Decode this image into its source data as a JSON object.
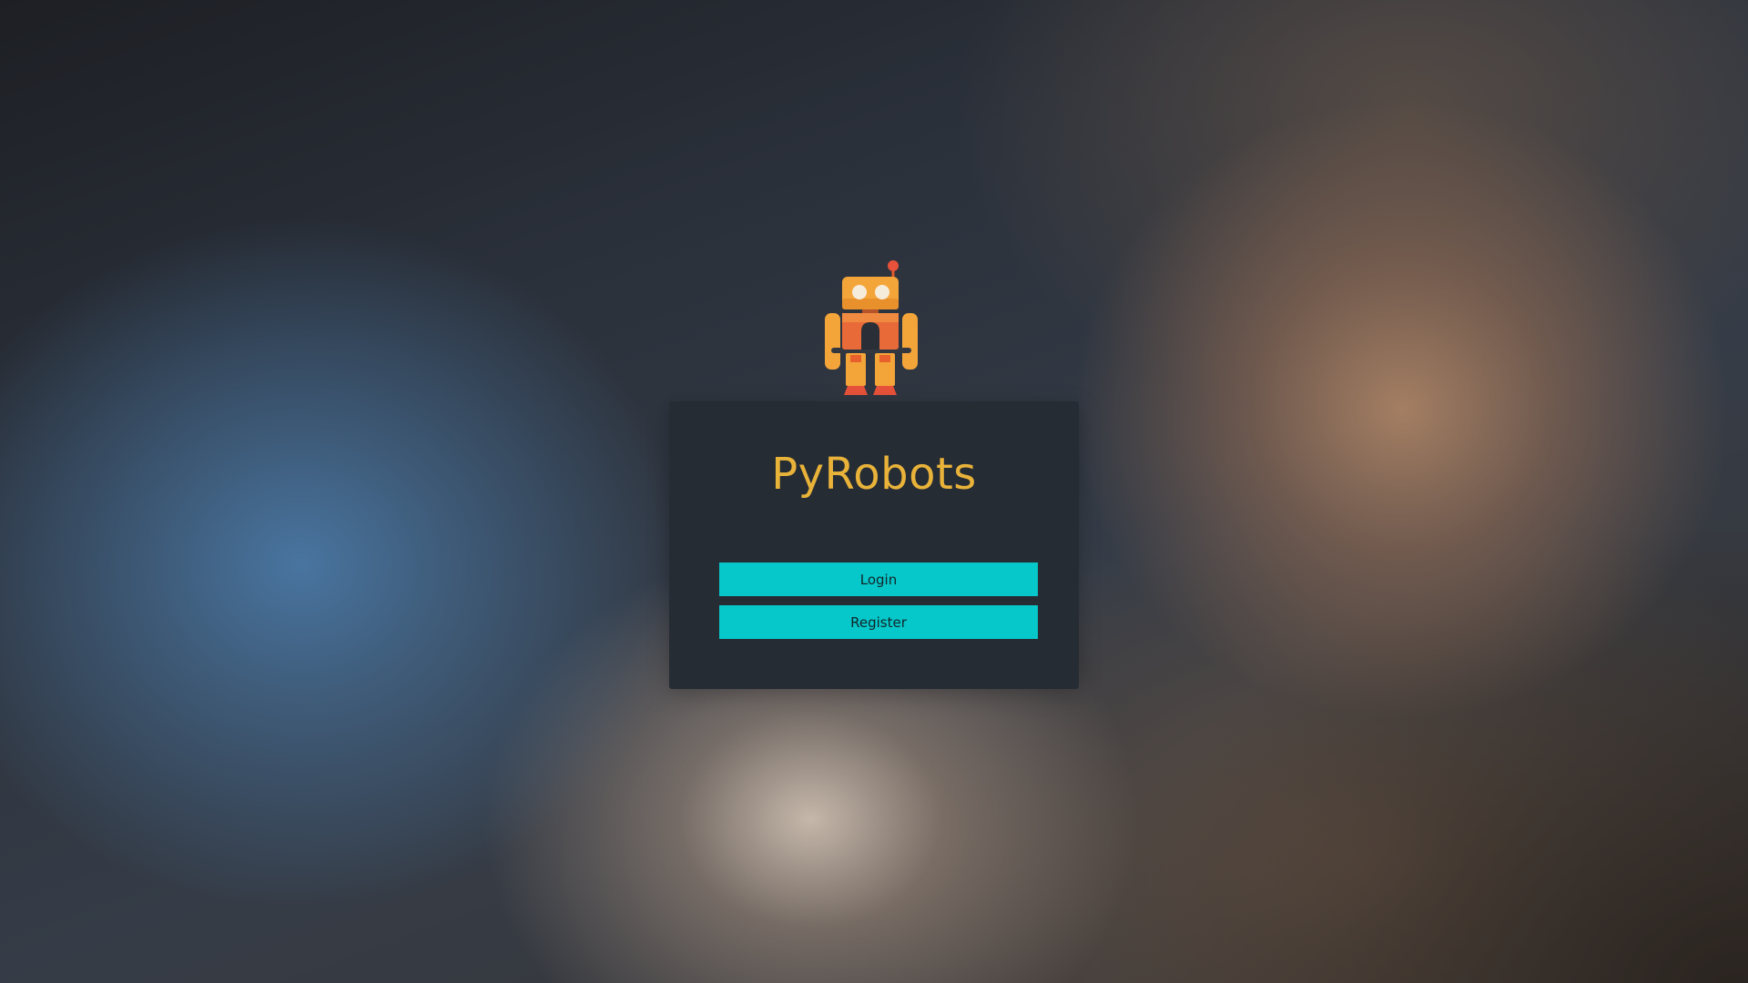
{
  "app": {
    "title": "PyRobots",
    "logo_icon": "robot-icon"
  },
  "actions": {
    "login_label": "Login",
    "register_label": "Register"
  },
  "colors": {
    "title": "#e9b33a",
    "button_bg": "#06c7c9",
    "card_bg": "#262c34"
  }
}
